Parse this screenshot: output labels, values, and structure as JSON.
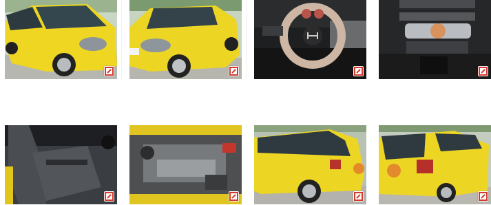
{
  "gallery": {
    "thumbnails": [
      {
        "subject": "front-left-exterior",
        "color": "#e8d21e"
      },
      {
        "subject": "front-right-exterior",
        "color": "#e8d21e"
      },
      {
        "subject": "steering-wheel-dashboard",
        "color": "#1d1d1d"
      },
      {
        "subject": "center-console-controls",
        "color": "#2a2a2a"
      },
      {
        "subject": "front-seats",
        "color": "#303338"
      },
      {
        "subject": "engine-bay",
        "color": "#5c5d5e"
      },
      {
        "subject": "side-rear-exterior",
        "color": "#e8d21e"
      },
      {
        "subject": "rear-exterior",
        "color": "#e8d21e"
      }
    ],
    "badge_icon": "watermark-logo-icon"
  }
}
